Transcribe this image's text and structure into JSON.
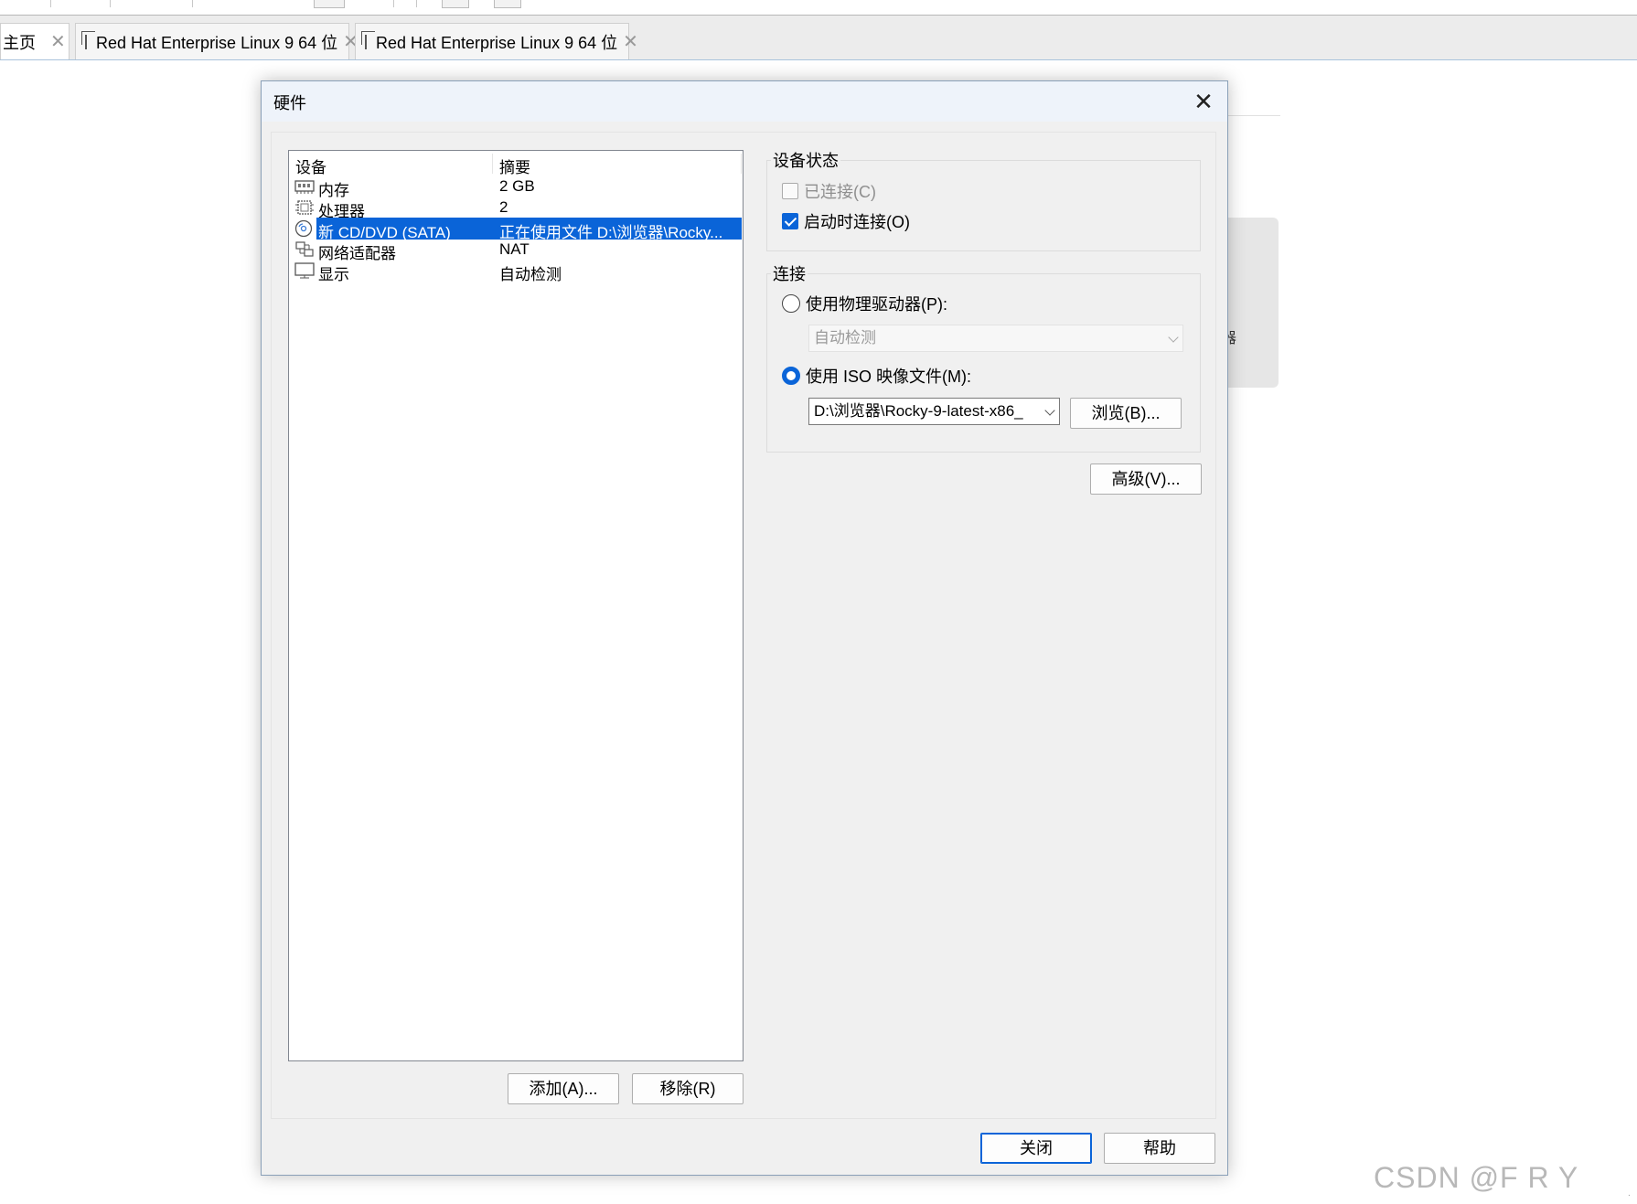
{
  "tabs": [
    {
      "label": "主页",
      "active": true
    },
    {
      "label": "Red Hat Enterprise Linux 9 64 位",
      "active": false
    },
    {
      "label": "Red Hat Enterprise Linux 9 64 位",
      "active": false
    }
  ],
  "dialog": {
    "title": "硬件",
    "close_glyph": "✕"
  },
  "device_list": {
    "col_device": "设备",
    "col_summary": "摘要",
    "rows": [
      {
        "name": "内存",
        "summary": "2 GB",
        "icon": "memory-icon"
      },
      {
        "name": "处理器",
        "summary": "2",
        "icon": "cpu-icon"
      },
      {
        "name": "新 CD/DVD (SATA)",
        "summary": "正在使用文件 D:\\浏览器\\Rocky...",
        "icon": "cd-dvd-icon",
        "selected": true
      },
      {
        "name": "网络适配器",
        "summary": "NAT",
        "icon": "network-adapter-icon"
      },
      {
        "name": "显示",
        "summary": "自动检测",
        "icon": "display-icon"
      }
    ]
  },
  "buttons": {
    "add": "添加(A)...",
    "remove": "移除(R)",
    "browse": "浏览(B)...",
    "advanced": "高级(V)...",
    "close": "关闭",
    "help": "帮助"
  },
  "device_status": {
    "title": "设备状态",
    "connected": {
      "label": "已连接(C)",
      "checked": false,
      "disabled": true
    },
    "connect_at_power_on": {
      "label": "启动时连接(O)",
      "checked": true,
      "disabled": false
    }
  },
  "connection": {
    "title": "连接",
    "physical_drive": {
      "label": "使用物理驱动器(P):",
      "selected": false
    },
    "physical_drive_select": "自动检测",
    "iso_image": {
      "label": "使用 ISO 映像文件(M):",
      "selected": true
    },
    "iso_path": "D:\\浏览器\\Rocky-9-latest-x86_"
  },
  "background": {
    "card_text": "器"
  },
  "watermark": "CSDN @F R Y",
  "colors": {
    "accent": "#0a64d8",
    "dialog_bg": "#f0f0f0",
    "titlebar_bg": "#eef3fa"
  }
}
